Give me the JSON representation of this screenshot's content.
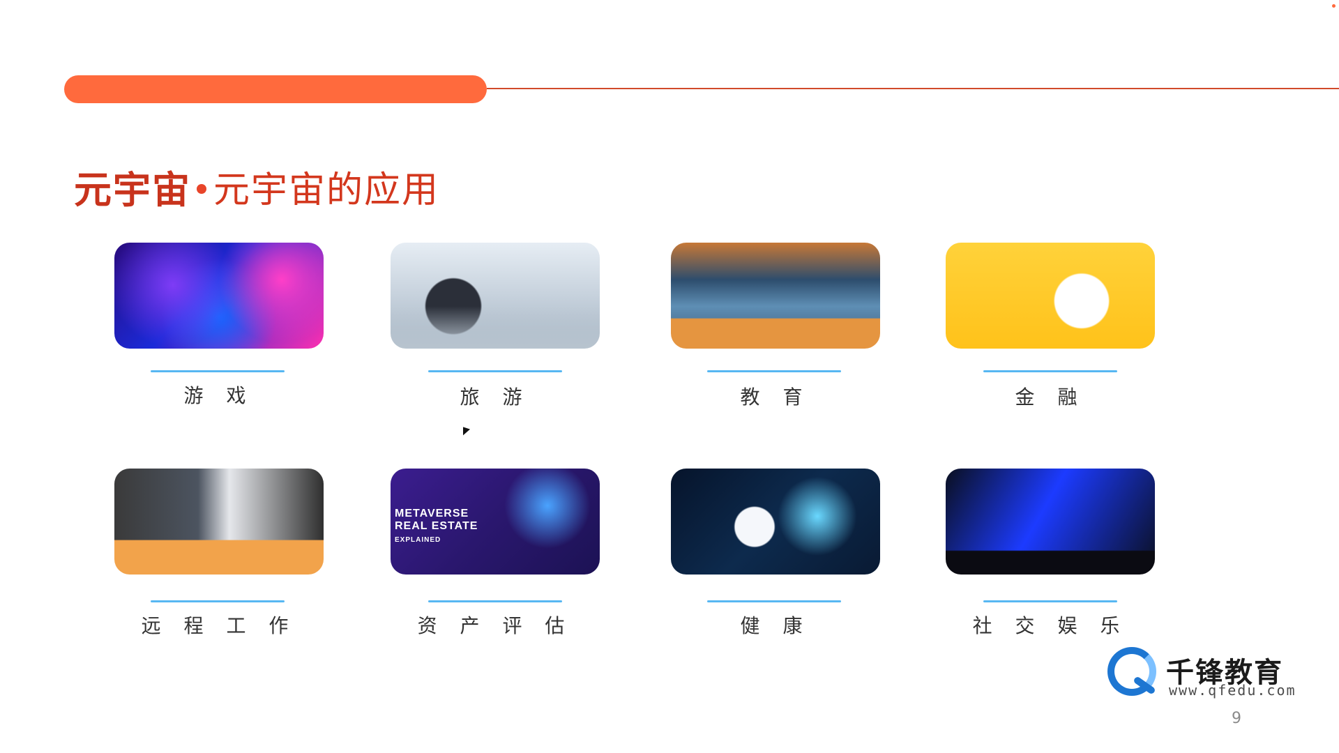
{
  "header": {
    "title_main": "元宇宙",
    "title_sub": "元宇宙的应用"
  },
  "apps": [
    {
      "label": "游 戏"
    },
    {
      "label": "旅 游"
    },
    {
      "label": "教 育"
    },
    {
      "label": "金 融"
    },
    {
      "label": "远 程 工 作"
    },
    {
      "label": "资 产 评 估"
    },
    {
      "label": "健 康"
    },
    {
      "label": "社 交 娱 乐"
    }
  ],
  "estate_image_text": {
    "line1": "METAVERSE",
    "line2": "REAL ESTATE",
    "line3": "EXPLAINED"
  },
  "logo": {
    "cn": "千锋教育",
    "url": "www.qfedu.com"
  },
  "page_number": "9",
  "colors": {
    "accent": "#ff6a3d",
    "title_red": "#c8331c",
    "underline_blue": "#57b7f2",
    "logo_blue": "#1d76d2"
  },
  "icons": {
    "logo_mark": "qfedu-logo-mark",
    "cursor": "mouse-cursor-icon"
  }
}
